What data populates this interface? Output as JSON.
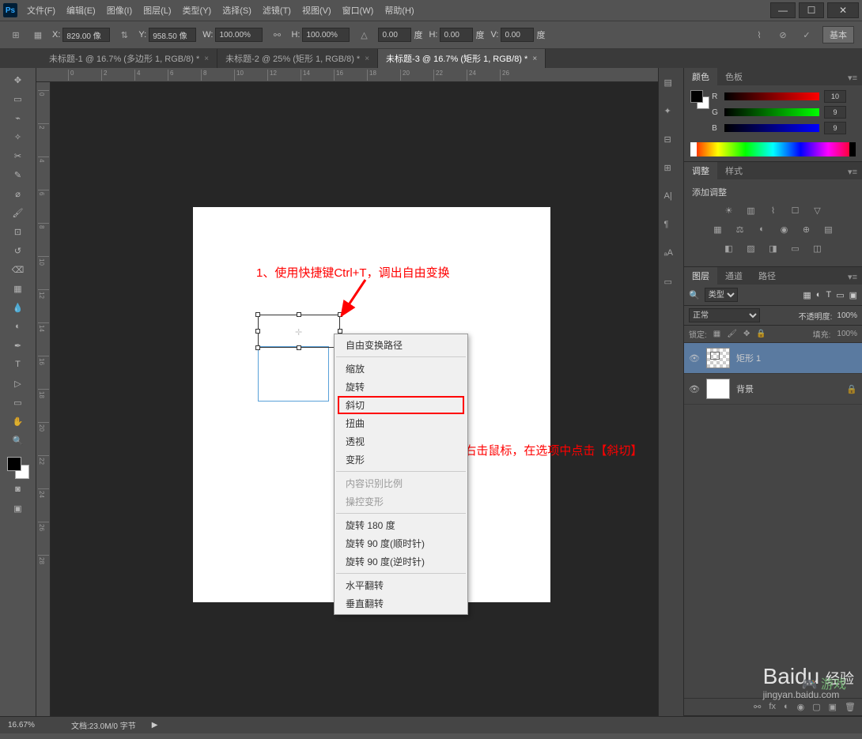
{
  "menubar": {
    "items": [
      "文件(F)",
      "编辑(E)",
      "图像(I)",
      "图层(L)",
      "类型(Y)",
      "选择(S)",
      "滤镜(T)",
      "视图(V)",
      "窗口(W)",
      "帮助(H)"
    ]
  },
  "options": {
    "x_label": "X:",
    "x_value": "829.00 像",
    "y_label": "Y:",
    "y_value": "958.50 像",
    "w_label": "W:",
    "w_value": "100.00%",
    "h_label": "H:",
    "h_value": "100.00%",
    "angle_value": "0.00",
    "angle_unit": "度",
    "h2_label": "H:",
    "h2_value": "0.00",
    "h2_unit": "度",
    "v_label": "V:",
    "v_value": "0.00",
    "v_unit": "度",
    "basic_btn": "基本"
  },
  "tabs": [
    {
      "label": "未标题-1 @ 16.7% (多边形 1, RGB/8) *",
      "active": false
    },
    {
      "label": "未标题-2 @ 25% (矩形 1, RGB/8) *",
      "active": false
    },
    {
      "label": "未标题-3 @ 16.7% (矩形 1, RGB/8) *",
      "active": true
    }
  ],
  "ruler_h": [
    "0",
    "2",
    "4",
    "6",
    "8",
    "10",
    "12",
    "14",
    "16",
    "18",
    "20",
    "22",
    "24",
    "26"
  ],
  "ruler_v": [
    "0",
    "2",
    "4",
    "6",
    "8",
    "10",
    "12",
    "14",
    "16",
    "18",
    "20",
    "22",
    "24",
    "26",
    "28"
  ],
  "annotations": {
    "a1": "1、使用快捷键Ctrl+T，调出自由变换",
    "a2": "2、右击鼠标，在选项中点击【斜切】"
  },
  "context_menu": {
    "items": [
      {
        "label": "自由变换路径",
        "type": "item"
      },
      {
        "type": "sep"
      },
      {
        "label": "缩放",
        "type": "item"
      },
      {
        "label": "旋转",
        "type": "item"
      },
      {
        "label": "斜切",
        "type": "highlight"
      },
      {
        "label": "扭曲",
        "type": "item"
      },
      {
        "label": "透视",
        "type": "item"
      },
      {
        "label": "变形",
        "type": "item"
      },
      {
        "type": "sep"
      },
      {
        "label": "内容识别比例",
        "type": "disabled"
      },
      {
        "label": "操控变形",
        "type": "disabled"
      },
      {
        "type": "sep"
      },
      {
        "label": "旋转 180 度",
        "type": "item"
      },
      {
        "label": "旋转 90 度(顺时针)",
        "type": "item"
      },
      {
        "label": "旋转 90 度(逆时针)",
        "type": "item"
      },
      {
        "type": "sep"
      },
      {
        "label": "水平翻转",
        "type": "item"
      },
      {
        "label": "垂直翻转",
        "type": "item"
      }
    ]
  },
  "panels": {
    "color": {
      "tab1": "颜色",
      "tab2": "色板",
      "r": "R",
      "g": "G",
      "b": "B",
      "rv": "10",
      "gv": "9",
      "bv": "9"
    },
    "adjust": {
      "tab1": "调整",
      "tab2": "样式",
      "title": "添加调整"
    },
    "layers": {
      "tab1": "图层",
      "tab2": "通道",
      "tab3": "路径",
      "kind": "类型",
      "blend": "正常",
      "opacity_label": "不透明度:",
      "opacity": "100%",
      "lock_label": "锁定:",
      "fill_label": "填充:",
      "fill": "100%",
      "items": [
        {
          "name": "矩形 1",
          "selected": true,
          "locked": false
        },
        {
          "name": "背景",
          "selected": false,
          "locked": true
        }
      ]
    }
  },
  "status": {
    "zoom": "16.67%",
    "doc": "文档:23.0M/0 字节"
  },
  "watermark": {
    "brand": "Baidu",
    "brand_suffix": "经验",
    "sub": "jingyan.baidu.com",
    "game": "游戏"
  }
}
